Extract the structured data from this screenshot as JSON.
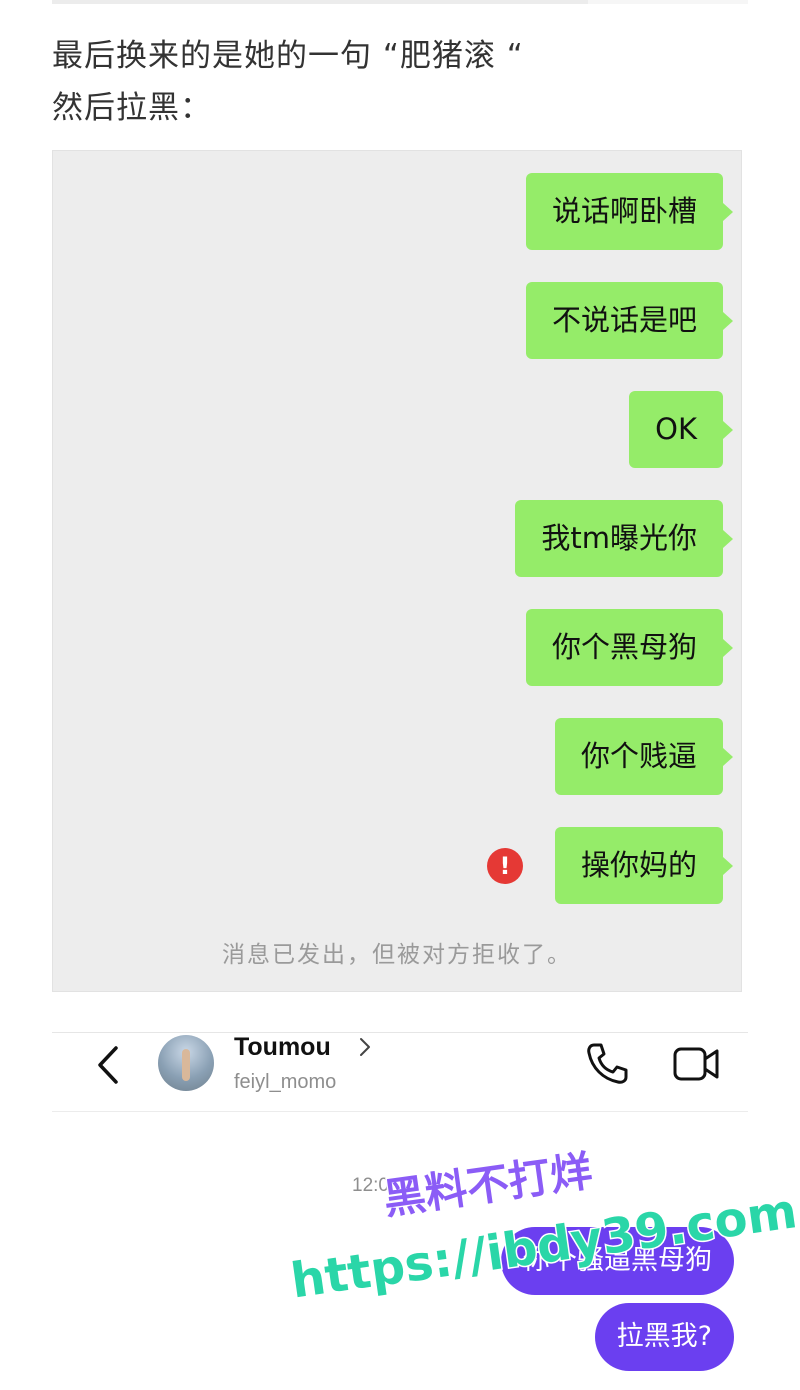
{
  "article": {
    "line1": "最后换来的是她的一句 “肥猪滚 “",
    "line2": "然后拉黑："
  },
  "wechat": {
    "messages": [
      "说话啊卧槽",
      "不说话是吧",
      "OK",
      "我tm曝光你",
      "你个黑母狗",
      "你个贱逼",
      "操你妈的"
    ],
    "error_mark": "!",
    "system_notice": "消息已发出，但被对方拒收了。",
    "bubble_color": "#95ec69"
  },
  "instagram": {
    "name": "Toumou",
    "handle": "feiyl_momo",
    "time": "12:0",
    "messages": [
      "你个骚逼黑母狗",
      "拉黑我?"
    ],
    "bubble_color": "#6b3ff0"
  },
  "watermark": {
    "line1": "黑料不打烊",
    "line2": "https://ibdy39.com"
  }
}
